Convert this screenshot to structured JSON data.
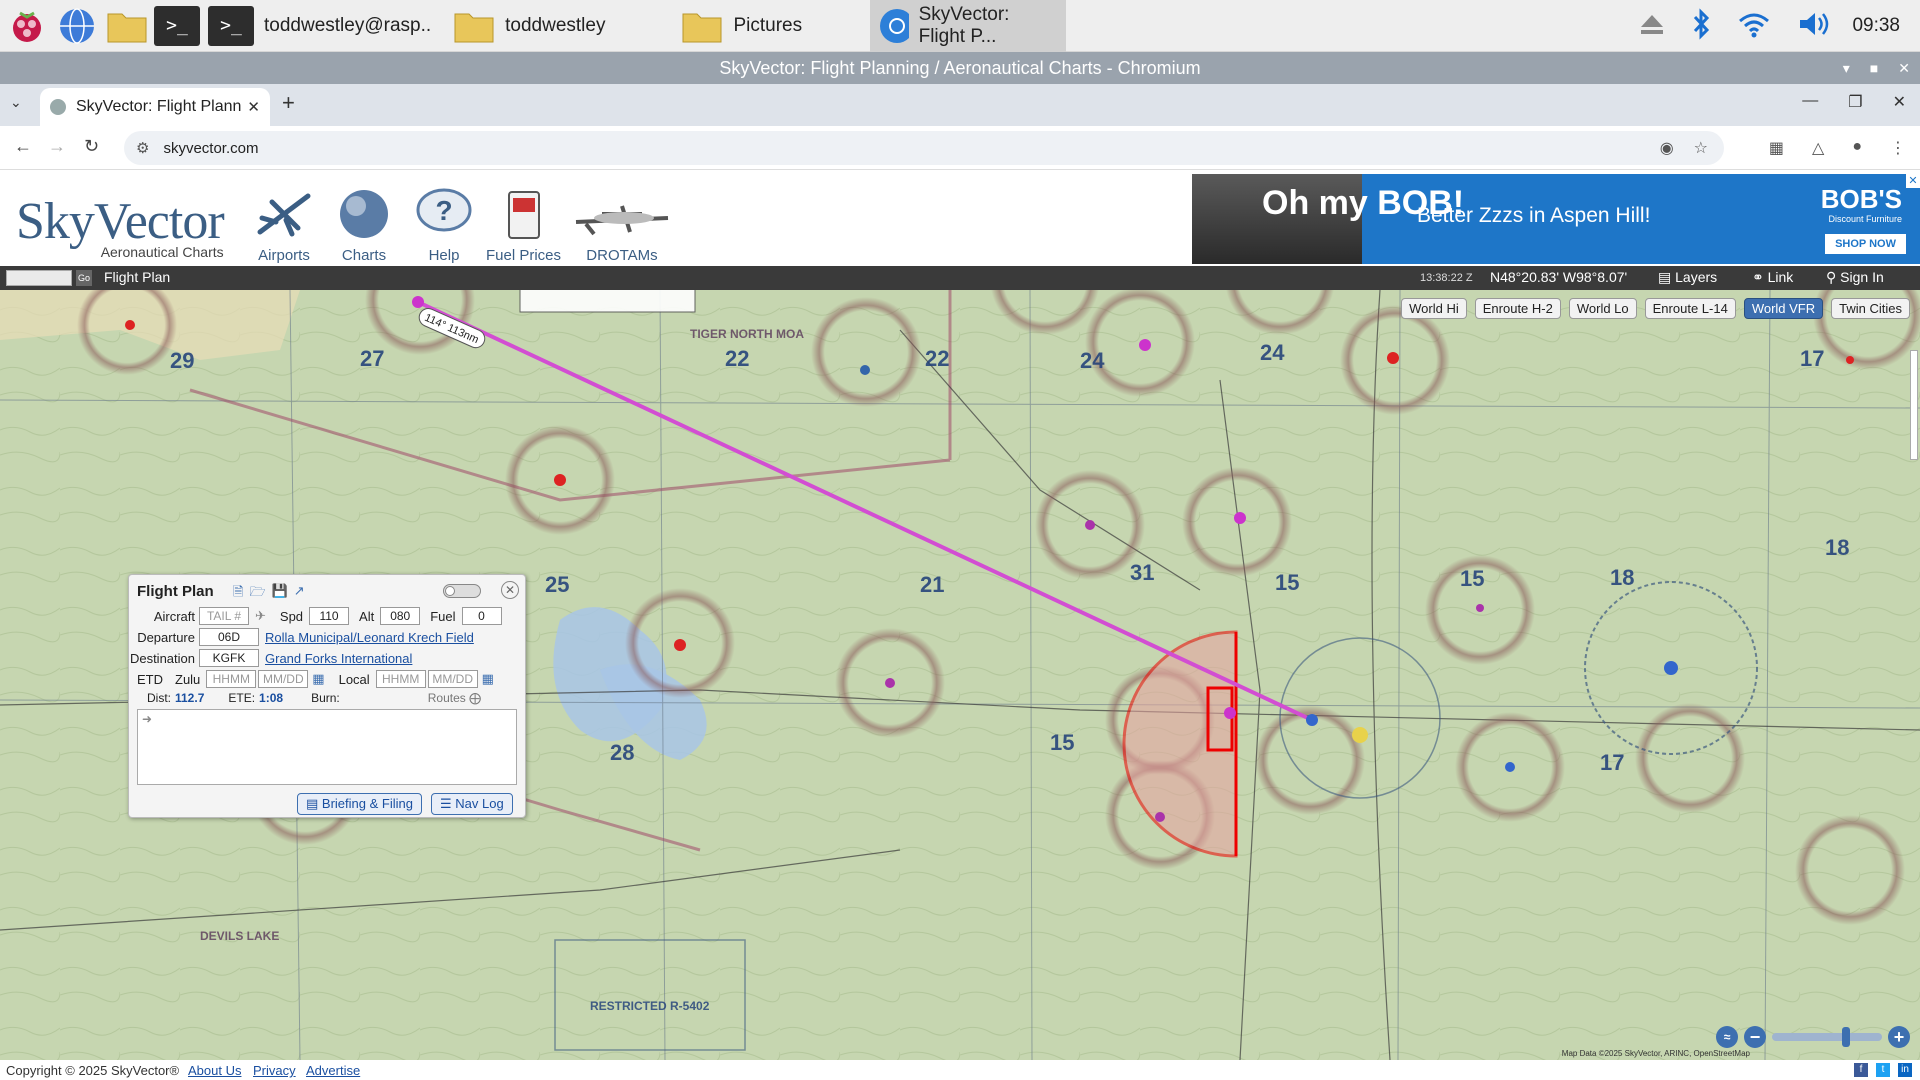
{
  "taskbar": {
    "terminal_label": "toddwestley@rasp..",
    "folder1_label": "toddwestley",
    "folder2_label": "Pictures",
    "browser_label": "SkyVector: Flight P...",
    "clock": "09:38"
  },
  "window": {
    "title": "SkyVector: Flight Planning / Aeronautical Charts - Chromium"
  },
  "browser": {
    "tab_title": "SkyVector: Flight Plann",
    "url": "skyvector.com"
  },
  "site": {
    "logo": "SkyVector",
    "logo_sub": "Aeronautical Charts",
    "nav": [
      "Airports",
      "Charts",
      "Help",
      "Fuel Prices",
      "DROTAMs"
    ],
    "ad": {
      "headline": "Better Zzzs in Aspen Hill!",
      "brand": "BOB'S",
      "brand_sub": "Discount Furniture",
      "shop": "SHOP NOW",
      "ohmy": "Oh my BOB!"
    }
  },
  "mapbar": {
    "flight_plan": "Flight Plan",
    "go": "Go",
    "utc": "13:38:22 Z",
    "coords": "N48°20.83' W98°8.07'",
    "layers": "Layers",
    "link": "Link",
    "signin": "Sign In"
  },
  "map": {
    "chart_buttons": [
      "World Hi",
      "Enroute H-2",
      "World Lo",
      "Enroute L-14",
      "World VFR",
      "Twin Cities"
    ],
    "selected_chart": "World VFR",
    "route_label": "114° 113nm",
    "attribution": "Map Data ©2025 SkyVector, ARINC, OpenStreetMap",
    "labels": [
      "TIGER NORTH MOA",
      "DEVILS LAKE",
      "RESTRICTED R-5402"
    ]
  },
  "flight_plan": {
    "title": "Flight Plan",
    "aircraft_label": "Aircraft",
    "aircraft_placeholder": "TAIL #",
    "spd_label": "Spd",
    "spd_value": "110",
    "alt_label": "Alt",
    "alt_value": "080",
    "fuel_label": "Fuel",
    "fuel_value": "0",
    "departure_label": "Departure",
    "departure_code": "06D",
    "departure_name": "Rolla Municipal/Leonard Krech Field",
    "destination_label": "Destination",
    "destination_code": "KGFK",
    "destination_name": "Grand Forks International",
    "etd_label": "ETD",
    "zulu_label": "Zulu",
    "local_label": "Local",
    "time_placeholder": "HHMM",
    "date_placeholder": "MM/DD",
    "dist_label": "Dist:",
    "dist_value": "112.7",
    "ete_label": "ETE:",
    "ete_value": "1:08",
    "burn_label": "Burn:",
    "routes_label": "Routes",
    "briefing_button": "Briefing & Filing",
    "navlog_button": "Nav Log"
  },
  "footer": {
    "copyright": "Copyright © 2025 SkyVector®",
    "links": [
      "About Us",
      "Privacy",
      "Advertise"
    ]
  }
}
